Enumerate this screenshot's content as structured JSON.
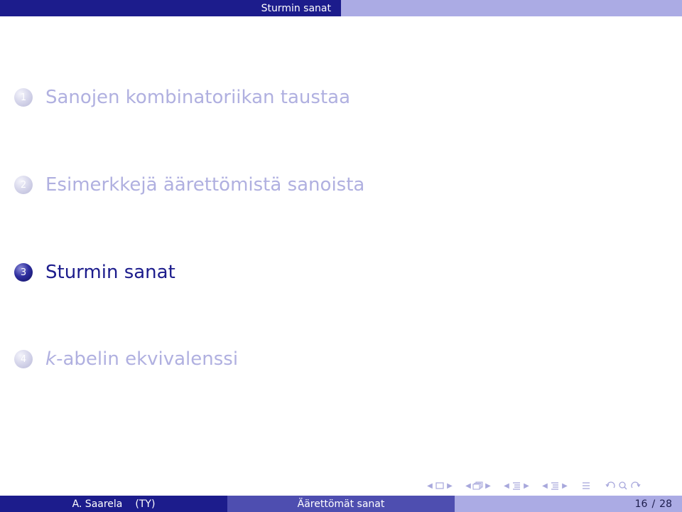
{
  "headline": {
    "section_title": "Sturmin sanat"
  },
  "toc": {
    "items": [
      {
        "number": "1",
        "label": "Sanojen kombinatoriikan taustaa",
        "active": false
      },
      {
        "number": "2",
        "label": "Esimerkkejä äärettömistä sanoista",
        "active": false
      },
      {
        "number": "3",
        "label": "Sturmin sanat",
        "active": true
      },
      {
        "number": "4",
        "label_math": "k",
        "label": "-abelin ekvivalenssi",
        "active": false
      }
    ]
  },
  "navigation": {
    "icons": [
      "frame-icon",
      "subsection-icon",
      "section-icon",
      "presentation-icon",
      "appendix-icon",
      "back-icon",
      "search-icon",
      "forward-icon"
    ]
  },
  "footer": {
    "author": "A. Saarela",
    "institute": "(TY)",
    "title": "Äärettömät sanat",
    "page_current": "16",
    "page_separator": "/",
    "page_total": "28"
  },
  "colors": {
    "primary": "#1c1c8c",
    "mid": "#4e4eb0",
    "light": "#ababe4",
    "inactive_text": "#b0b0e0"
  }
}
